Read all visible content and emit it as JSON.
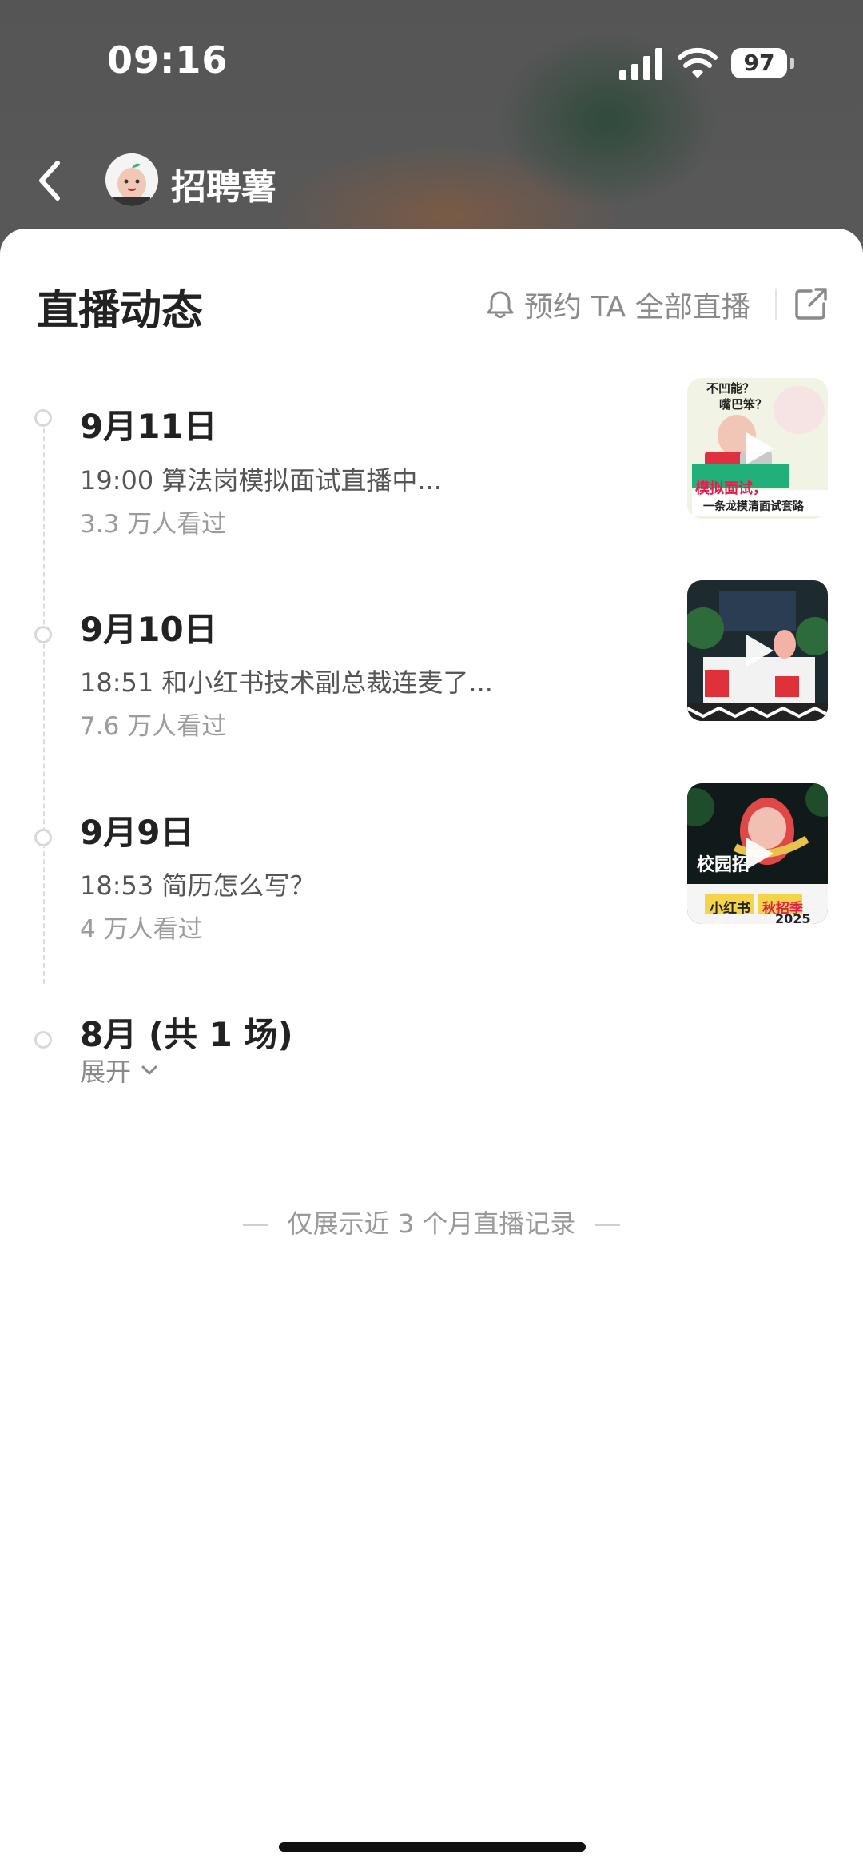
{
  "status_bar": {
    "time": "09:16",
    "battery": "97"
  },
  "nav": {
    "title": "招聘薯",
    "back_icon": "chevron-left-icon",
    "avatar_icon": "avatar"
  },
  "sheet": {
    "title": "直播动态",
    "reserve_label": "预约 TA 全部直播",
    "reserve_icon": "bell-icon",
    "share_icon": "share-icon"
  },
  "timeline": [
    {
      "date": "9月11日",
      "desc": "19:00 算法岗模拟面试直播中...",
      "views": "3.3 万人看过",
      "thumb": {
        "line1": "不凹能？",
        "line2": "嘴巴笨？",
        "line3": "模拟面试，",
        "line4": "一条龙摸清面试套路"
      }
    },
    {
      "date": "9月10日",
      "desc": "18:51 和小红书技术副总裁连麦了...",
      "views": "7.6 万人看过",
      "thumb": {}
    },
    {
      "date": "9月9日",
      "desc": "18:53 简历怎么写？",
      "views": "4 万人看过",
      "thumb": {
        "line1": "校园招",
        "line2": "小红书",
        "line3": "秋招季",
        "line4": "2025"
      }
    }
  ],
  "august": {
    "label": "8月 (共 1 场)",
    "expand_label": "展开"
  },
  "footnote": "仅展示近 3 个月直播记录",
  "colors": {
    "accent_red": "#ff2442",
    "timeline_gray": "#d8d8d8"
  }
}
